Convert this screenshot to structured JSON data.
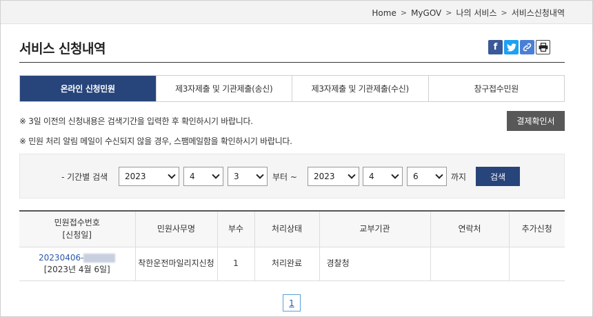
{
  "breadcrumb": [
    "Home",
    "MyGOV",
    "나의 서비스",
    "서비스신청내역"
  ],
  "page_title": "서비스 신청내역",
  "share_icons": [
    "facebook-icon",
    "twitter-icon",
    "link-icon",
    "print-icon"
  ],
  "tabs": [
    {
      "label": "온라인 신청민원",
      "active": true
    },
    {
      "label": "제3자제출 및 기관제출(송신)",
      "active": false
    },
    {
      "label": "제3자제출 및 기관제출(수신)",
      "active": false
    },
    {
      "label": "창구접수민원",
      "active": false
    }
  ],
  "notices": [
    "※ 3일 이전의 신청내용은 검색기간을 입력한 후 확인하시기 바랍니다.",
    "※ 민원 처리 알림 메일이 수신되지 않을 경우, 스팸메일함을 확인하시기 바랍니다."
  ],
  "confirm_button": "결제확인서",
  "search": {
    "label": "- 기간별 검색",
    "from_year": "2023",
    "from_month": "4",
    "from_day": "3",
    "from_suffix": "부터 ~",
    "to_year": "2023",
    "to_month": "4",
    "to_day": "6",
    "to_suffix": "까지",
    "button": "검색"
  },
  "table": {
    "headers": [
      "민원접수번호",
      "[신청일]",
      "민원사무명",
      "부수",
      "처리상태",
      "교부기관",
      "연락처",
      "추가신청"
    ],
    "rows": [
      {
        "receipt_no": "20230406-",
        "date": "[2023년 4월 6일]",
        "service": "착한운전마일리지신청",
        "copies": "1",
        "status": "처리완료",
        "agency": "경찰청",
        "contact": "",
        "extra": ""
      }
    ]
  },
  "pager": {
    "current": "1"
  },
  "colors": {
    "primary": "#27447b",
    "gray_button": "#585858",
    "facebook": "#3b5998",
    "twitter": "#1da1f2"
  }
}
